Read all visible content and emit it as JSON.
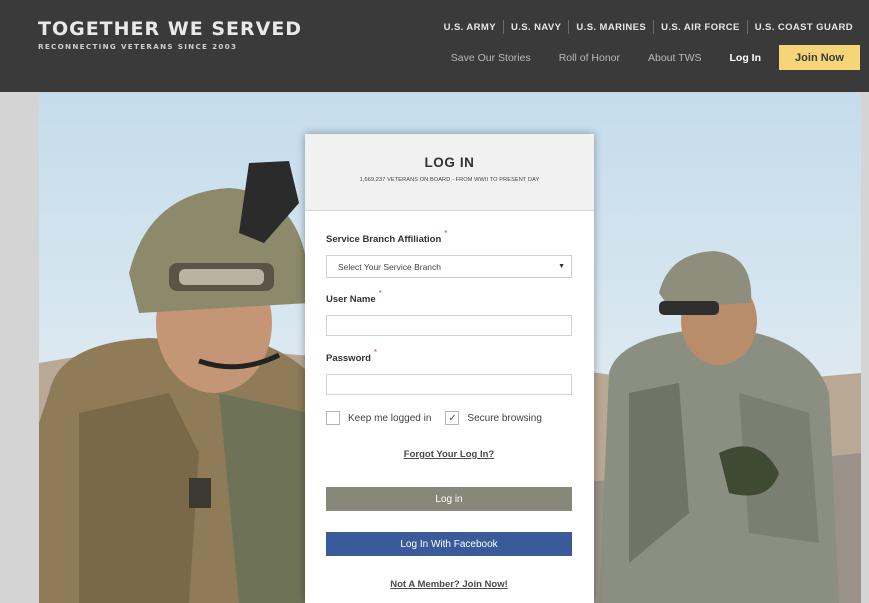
{
  "brand": {
    "title": "TOGETHER WE SERVED",
    "tagline": "RECONNECTING VETERANS SINCE 2003"
  },
  "branches": [
    "U.S. ARMY",
    "U.S. NAVY",
    "U.S. MARINES",
    "U.S. AIR FORCE",
    "U.S. COAST GUARD"
  ],
  "nav": {
    "save_stories": "Save Our Stories",
    "roll_of_honor": "Roll of Honor",
    "about": "About TWS",
    "login": "Log In",
    "join": "Join Now"
  },
  "login_card": {
    "title": "LOG IN",
    "subtitle": "1,669,237 VETERANS ON BOARD - FROM WWII TO PRESENT DAY",
    "branch_label": "Service Branch Affiliation",
    "branch_placeholder": "Select Your Service Branch",
    "username_label": "User Name",
    "password_label": "Password",
    "required_mark": "*",
    "keep_logged_in": "Keep me logged in",
    "secure_browsing": "Secure browsing",
    "secure_checked_mark": "✓",
    "forgot_link": "Forgot Your Log In?",
    "login_button": "Log in",
    "facebook_button": "Log In With Facebook",
    "join_link": "Not A Member? Join Now!"
  },
  "colors": {
    "header_bg": "#3a3a3a",
    "join_btn": "#f5d577",
    "login_btn": "#87877a",
    "facebook_btn": "#3b5a99"
  }
}
